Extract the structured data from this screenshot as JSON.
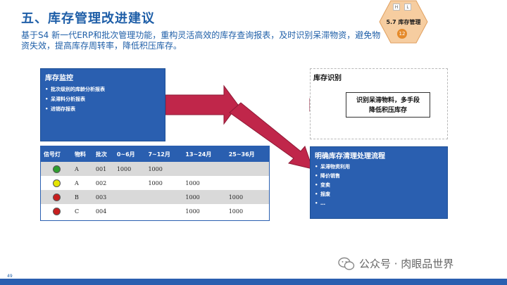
{
  "header": {
    "title": "五、库存管理改进建议",
    "subtitle": "基于S4 新一代ERP和批次管理功能，重构灵活高效的库存查询报表，及时识别呆滞物资，避免物资失效，提高库存周转率，降低积压库存。"
  },
  "badge": {
    "label": "5.7 库存管理",
    "number": "12",
    "chip_left": "H",
    "chip_right": "L"
  },
  "monitor": {
    "title": "库存监控",
    "items": [
      "批次级别的库龄分析报表",
      "呆滞料分析报表",
      "进销存报表"
    ]
  },
  "identify": {
    "title": "库存识别",
    "box_line1": "识别呆滞物料，多手段",
    "box_line2": "降低积压库存"
  },
  "process": {
    "title": "明确库存清理处理流程",
    "items": [
      "呆滞物资利用",
      "降价销售",
      "变卖",
      "报废",
      "…"
    ]
  },
  "table": {
    "headers": [
      "信号灯",
      "物料",
      "批次",
      "0~6月",
      "7~12月",
      "13~24月",
      "25~36月"
    ],
    "rows": [
      {
        "light": "#2e9e2e",
        "material": "A",
        "batch": "001",
        "c1": "1000",
        "c2": "1000",
        "c3": "",
        "c4": ""
      },
      {
        "light": "#e6e600",
        "material": "A",
        "batch": "002",
        "c1": "",
        "c2": "1000",
        "c3": "1000",
        "c4": ""
      },
      {
        "light": "#c81e1e",
        "material": "B",
        "batch": "003",
        "c1": "",
        "c2": "",
        "c3": "1000",
        "c4": "1000"
      },
      {
        "light": "#c81e1e",
        "material": "C",
        "batch": "004",
        "c1": "",
        "c2": "",
        "c3": "1000",
        "c4": "1000"
      }
    ]
  },
  "colors": {
    "brand_blue": "#2a5fb0",
    "arrow_red": "#c0264a"
  },
  "footer": {
    "watermark": "公众号 · 肉眼品世界",
    "page_number": "49"
  }
}
